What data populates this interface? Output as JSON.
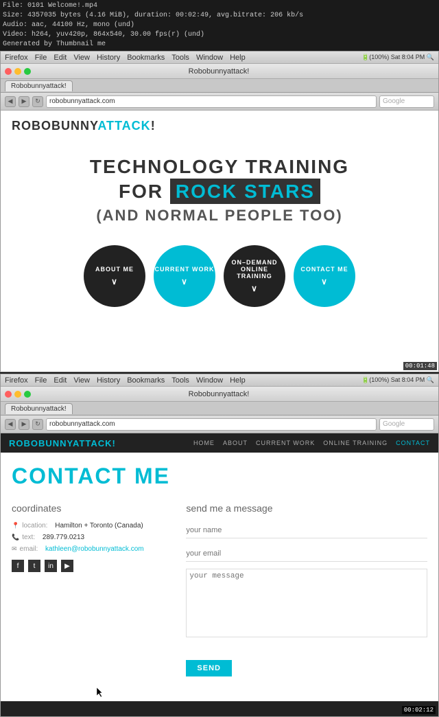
{
  "file_info": {
    "line1": "File: 0101 Welcome!.mp4",
    "line2": "Size: 4357035 bytes (4.16 MiB), duration: 00:02:49, avg.bitrate: 206 kb/s",
    "line3": "Audio: aac, 44100 Hz, mono (und)",
    "line4": "Video: h264, yuv420p, 864x540, 30.00 fps(r) (und)",
    "line5": "Generated by Thumbnail me"
  },
  "browser1": {
    "title": "Robobunnyattack!",
    "tab_label": "Robobunnyattack!",
    "url": "robobunnyattack.com",
    "timestamp": "00:01:48"
  },
  "site1": {
    "logo_main": "ROBOBUNNY",
    "logo_accent": "ATTACK",
    "logo_suffix": "!",
    "hero_line1": "TECHNOLOGY TRAINING",
    "hero_line2a": "FOR",
    "hero_line2b": "ROCK STARS",
    "hero_line3": "(AND NORMAL PEOPLE TOO)",
    "circles": [
      {
        "label": "ABOUT ME",
        "type": "dark"
      },
      {
        "label": "CURRENT WORK",
        "type": "teal"
      },
      {
        "label": "ON-DEMAND\nONLINE TRAINING",
        "type": "dark"
      },
      {
        "label": "CONTACT ME",
        "type": "teal"
      }
    ]
  },
  "browser2": {
    "title": "Robobunnyattack!",
    "tab_label": "Robobunnyattack!",
    "url": "robobunnyattack.com",
    "timestamp": "00:02:12"
  },
  "site2": {
    "logo_main": "ROBOBUNNY",
    "logo_accent": "ATTACK",
    "logo_suffix": "!",
    "nav_links": [
      "HOME",
      "ABOUT",
      "CURRENT WORK",
      "ONLINE TRAINING",
      "CONTACT"
    ],
    "contact_title_main": "CONTACT",
    "contact_title_accent": "ME",
    "coordinates_heading": "coordinates",
    "location_label": "location:",
    "location_value": "Hamilton + Toronto (Canada)",
    "text_label": "text:",
    "text_value": "289.779.0213",
    "email_label": "email:",
    "email_value": "kathleen@robobunnyattack.com",
    "message_heading": "send me a message",
    "name_placeholder": "your name",
    "email_placeholder": "your email",
    "message_placeholder": "your message",
    "send_label": "SEND"
  }
}
